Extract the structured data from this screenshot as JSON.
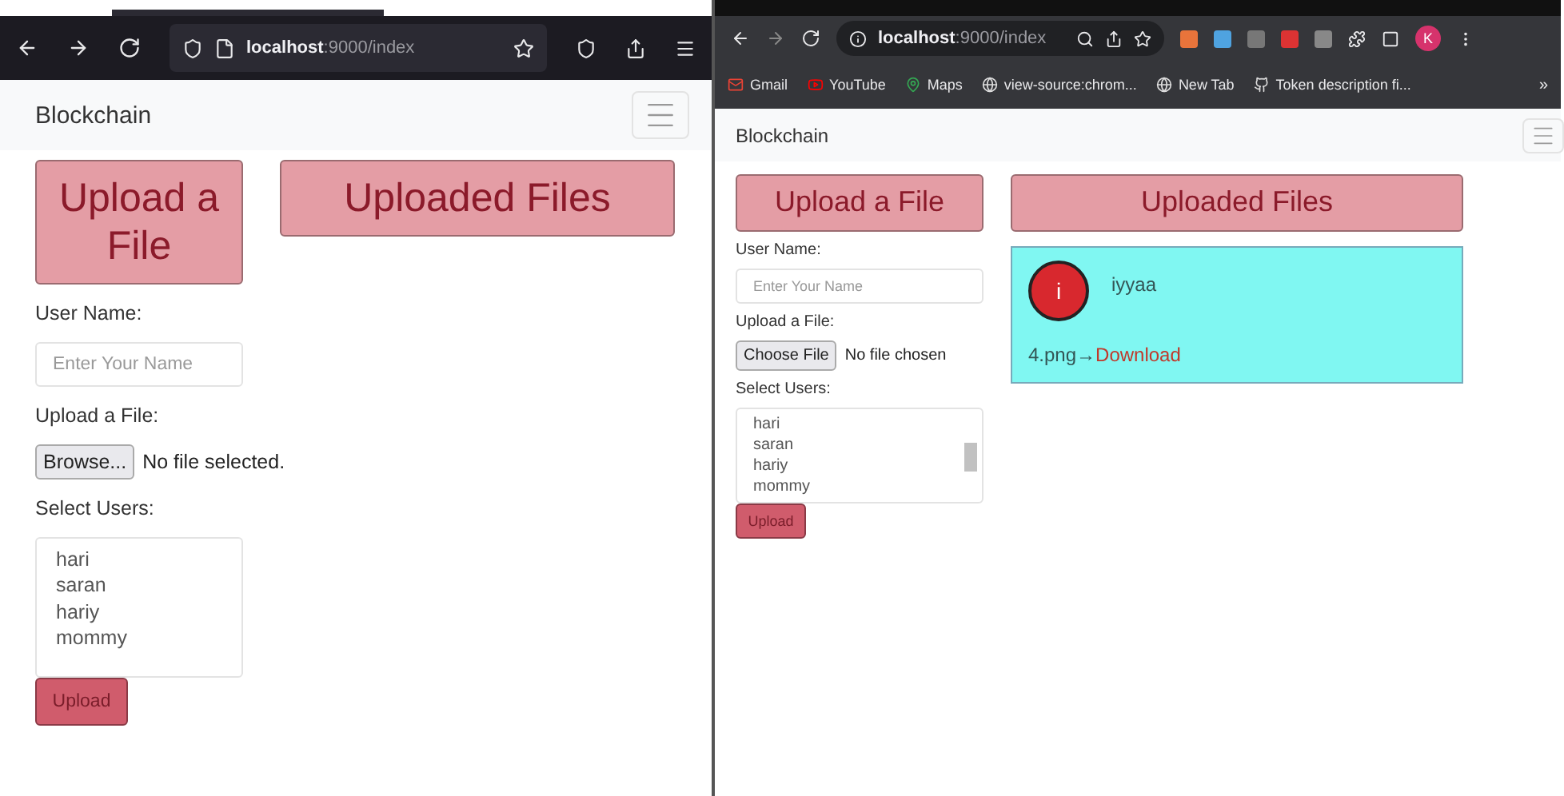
{
  "windows": [
    {
      "kind": "firefox",
      "address": "**localhost**:9000/index",
      "brand": "Blockchain",
      "headings": [
        "Upload a File",
        "Uploaded Files"
      ],
      "form": {
        "user_label": "User Name:",
        "placeholder": "Enter Your Name",
        "file_label": "Upload a File:",
        "file_button": "Browse...",
        "file_status": "No file selected.",
        "users_label": "Select Users:",
        "users": [
          "hari",
          "saran",
          "hariy",
          "mommy"
        ],
        "submit": "Upload"
      }
    },
    {
      "kind": "chrome",
      "address": "**localhost**:9000/index",
      "avatar": "K",
      "bookmarks": [
        {
          "label": "Gmail",
          "kind": "mail"
        },
        {
          "label": "YouTube",
          "kind": "video"
        },
        {
          "label": "Maps",
          "kind": "pin"
        },
        {
          "label": "view-source:chrom...",
          "kind": "globe"
        },
        {
          "label": "New Tab",
          "kind": "globe"
        },
        {
          "label": "Token description fi...",
          "kind": "octo"
        }
      ],
      "bookmarks_more": "»",
      "brand": "Blockchain",
      "headings": [
        "Upload a File",
        "Uploaded Files"
      ],
      "form": {
        "user_label": "User Name:",
        "placeholder": "Enter Your Name",
        "file_label": "Upload a File:",
        "file_button": "Choose File",
        "file_status": "No file chosen",
        "users_label": "Select Users:",
        "users": [
          "hari",
          "saran",
          "hariy",
          "mommy"
        ],
        "submit": "Upload"
      },
      "files": [
        {
          "initial": "i",
          "user": "iyyaa",
          "file": "4.png→",
          "link": "Download"
        }
      ]
    }
  ]
}
